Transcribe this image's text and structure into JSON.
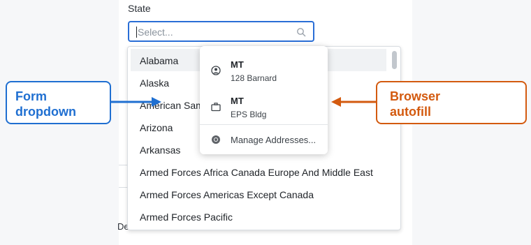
{
  "form": {
    "field_label": "State",
    "select_placeholder": "Select...",
    "bottom_partial_label": "De"
  },
  "dropdown": {
    "items": [
      {
        "label": "Alabama"
      },
      {
        "label": "Alaska"
      },
      {
        "label": "American Sam"
      },
      {
        "label": "Arizona"
      },
      {
        "label": "Arkansas"
      },
      {
        "label": "Armed Forces Africa Canada Europe And Middle East"
      },
      {
        "label": "Armed Forces Americas Except Canada"
      },
      {
        "label": "Armed Forces Pacific"
      }
    ],
    "highlighted_index": 0
  },
  "autofill": {
    "entries": [
      {
        "title": "MT",
        "subtitle": "128 Barnard",
        "icon": "person-circle-icon"
      },
      {
        "title": "MT",
        "subtitle": "EPS Bldg",
        "icon": "briefcase-icon"
      }
    ],
    "manage_label": "Manage Addresses...",
    "manage_icon": "chrome-logo-icon"
  },
  "annotations": {
    "left_callout": {
      "line1": "Form",
      "line2": "dropdown",
      "color": "#1f6fd1"
    },
    "right_callout": {
      "line1": "Browser",
      "line2": "autofill",
      "color": "#d35a0f"
    }
  },
  "colors": {
    "focus_border": "#2a6ed6",
    "highlight_row": "#f0f2f4"
  }
}
